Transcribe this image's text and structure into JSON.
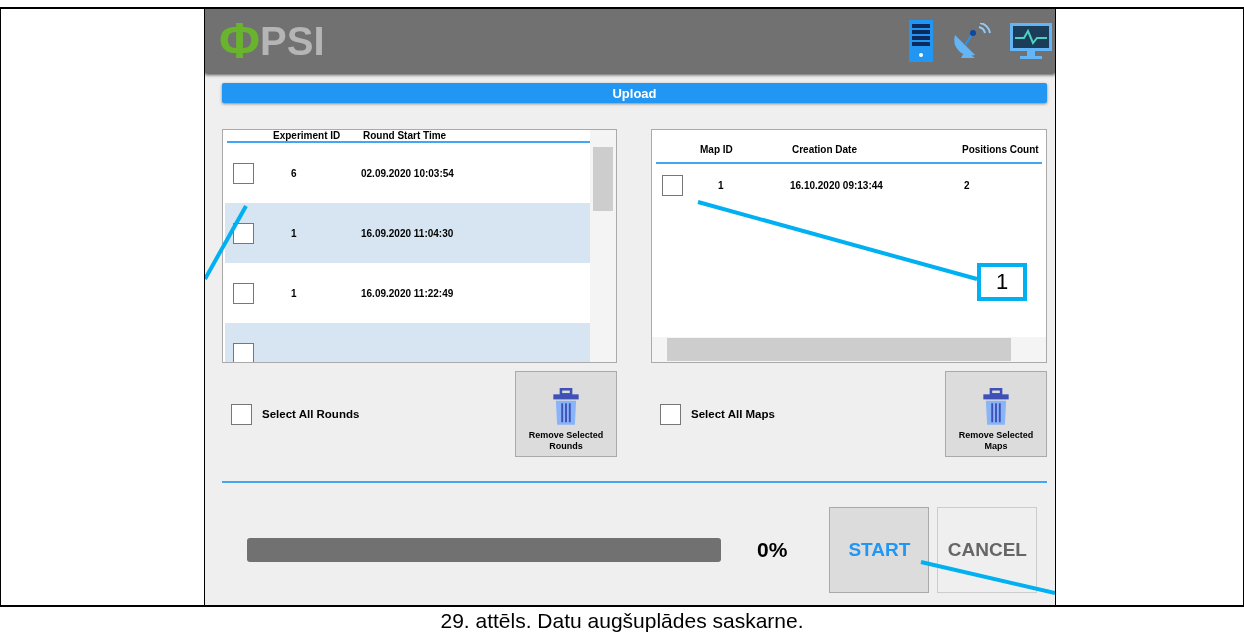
{
  "app": {
    "logo_symbol": "Φ",
    "logo_text": "PSI",
    "section_title": "Upload",
    "rounds_table": {
      "columns": [
        "Experiment ID",
        "Round Start Time"
      ],
      "rows": [
        {
          "checked": false,
          "cells": [
            "6",
            "02.09.2020 10:03:54"
          ]
        },
        {
          "checked": false,
          "cells": [
            "1",
            "16.09.2020 11:04:30"
          ]
        },
        {
          "checked": false,
          "cells": [
            "1",
            "16.09.2020 11:22:49"
          ]
        },
        {
          "checked": false
        }
      ]
    },
    "maps_table": {
      "columns": [
        "Map ID",
        "Creation Date",
        "Positions Count"
      ],
      "rows": [
        {
          "checked": false,
          "cells": [
            "1",
            "16.10.2020 09:13:44",
            "2"
          ]
        }
      ]
    },
    "select_all_rounds": {
      "label": "Select All Rounds",
      "checked": false
    },
    "remove_rounds_button": "Remove Selected Rounds",
    "select_all_maps": {
      "label": "Select All Maps",
      "checked": false
    },
    "remove_maps_button": "Remove Selected Maps",
    "progress": {
      "level": 0,
      "reading": "0%"
    },
    "buttons": [
      {
        "label": "START",
        "kind": "primary"
      },
      {
        "label": "CANCEL",
        "kind": "secondary"
      }
    ]
  },
  "callouts": [
    {
      "label": "1"
    }
  ],
  "caption": "29. attēls. Datu augšuplādes saskarne."
}
